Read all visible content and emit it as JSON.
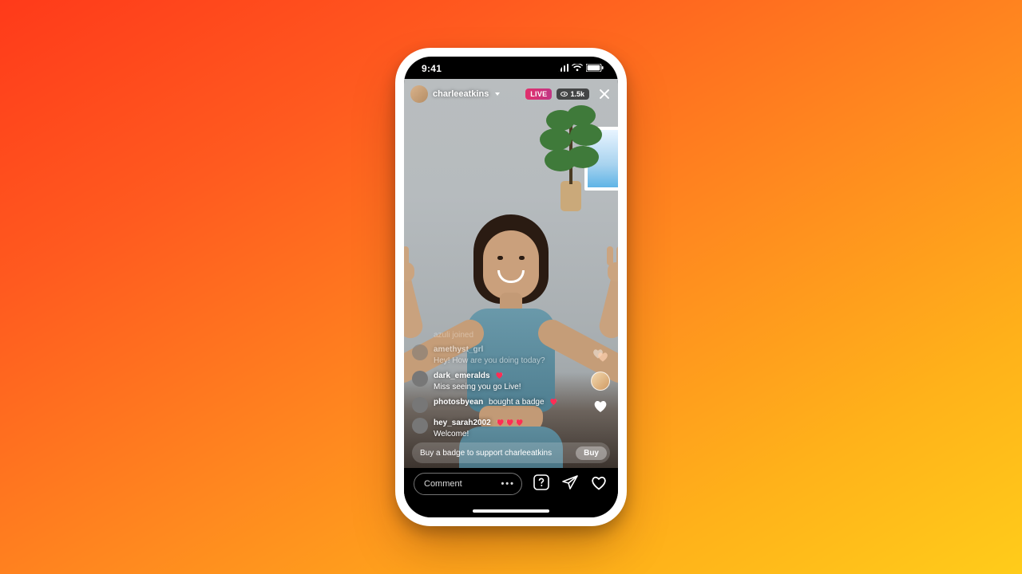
{
  "status": {
    "time": "9:41"
  },
  "header": {
    "username": "charleeatkins",
    "live_label": "LIVE",
    "viewer_count": "1.5k"
  },
  "feed": {
    "joined_line": "azuli joined",
    "comments": [
      {
        "name": "amethyst_grl",
        "body": "Hey! How are you doing today?",
        "faded": true
      },
      {
        "name": "dark_emeralds",
        "body": "Miss seeing you go Live!",
        "badge_count": 1
      },
      {
        "name": "photosbyean",
        "body": "bought a badge",
        "inline": true,
        "badge_count": 1
      },
      {
        "name": "hey_sarah2002",
        "body": "Welcome!",
        "badge_count": 3
      }
    ]
  },
  "banner": {
    "message": "Buy a badge to support charleeatkins",
    "buy_label": "Buy"
  },
  "bottom": {
    "comment_placeholder": "Comment",
    "dots": "•••"
  }
}
